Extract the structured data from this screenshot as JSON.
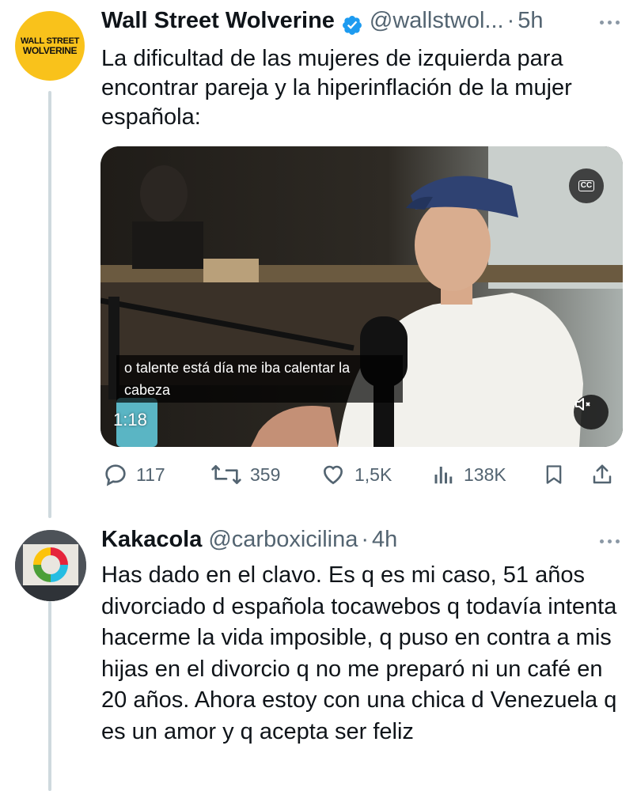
{
  "tweet": {
    "avatar_text_line1": "WALL STREET",
    "avatar_text_line2": "WOLVERINE",
    "name": "Wall Street Wolverine",
    "handle": "@wallstwol...",
    "separator": "·",
    "time": "5h",
    "text": "La dificultad de las mujeres de izquierda para encontrar pareja y la hiperinflación de la mujer española:",
    "video": {
      "subtitle": "o talente está día me iba calentar la cabeza",
      "duration": "1:18",
      "cc_label": "CC"
    },
    "stats": {
      "replies": "117",
      "reposts": "359",
      "likes": "1,5K",
      "views": "138K"
    }
  },
  "reply": {
    "name": "Kakacola",
    "handle": "@carboxicilina",
    "separator": "·",
    "time": "4h",
    "text": "Has dado en el clavo. Es q es mi caso, 51 años divorciado d española tocawebos q todavía intenta hacerme la vida imposible, q puso en contra a mis hijas en el divorcio q no me preparó ni un café en 20 años. Ahora estoy con una chica d Venezuela q es un amor y q acepta ser feliz"
  },
  "colors": {
    "verified": "#1d9bf0",
    "secondary_text": "#536471",
    "thread_line": "#cfd9de",
    "avatar_bg": "#f9c21b"
  }
}
